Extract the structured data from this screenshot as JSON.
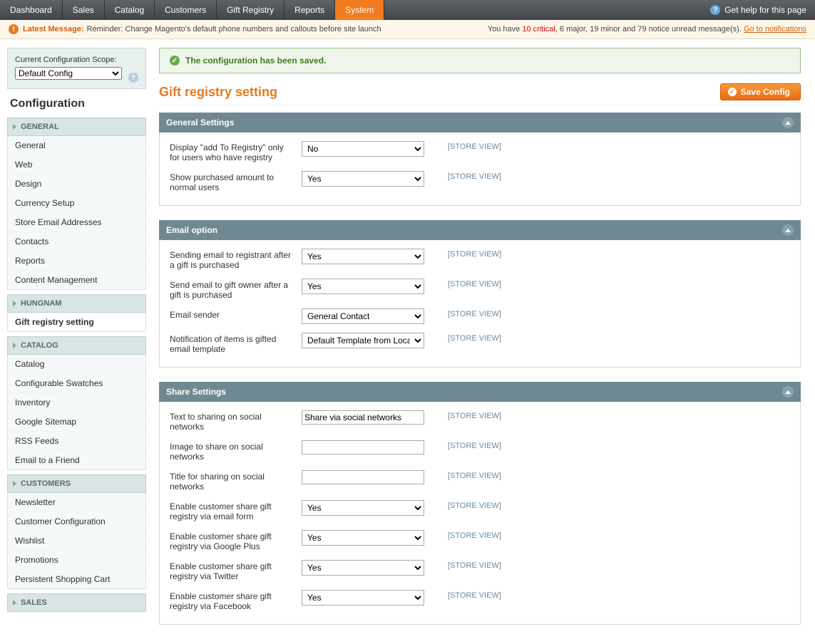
{
  "topnav": {
    "items": [
      "Dashboard",
      "Sales",
      "Catalog",
      "Customers",
      "Gift Registry",
      "Reports",
      "System"
    ],
    "active_index": 6,
    "help_label": "Get help for this page"
  },
  "noticebar": {
    "latest_label": "Latest Message:",
    "message": "Reminder: Change Magento's default phone numbers and callouts before site launch",
    "summary_pre": "You have ",
    "critical": "10 critical",
    "summary_mid": ", 6 major, 19 minor and 79 notice unread message(s). ",
    "link": "Go to notifications"
  },
  "scope": {
    "label": "Current Configuration Scope:",
    "value": "Default Config"
  },
  "sidebar_title": "Configuration",
  "groups": [
    {
      "title": "GENERAL",
      "items": [
        "General",
        "Web",
        "Design",
        "Currency Setup",
        "Store Email Addresses",
        "Contacts",
        "Reports",
        "Content Management"
      ]
    },
    {
      "title": "HUNGNAM",
      "items": [
        "Gift registry setting"
      ],
      "active_index": 0
    },
    {
      "title": "CATALOG",
      "items": [
        "Catalog",
        "Configurable Swatches",
        "Inventory",
        "Google Sitemap",
        "RSS Feeds",
        "Email to a Friend"
      ]
    },
    {
      "title": "CUSTOMERS",
      "items": [
        "Newsletter",
        "Customer Configuration",
        "Wishlist",
        "Promotions",
        "Persistent Shopping Cart"
      ]
    },
    {
      "title": "SALES",
      "items": []
    }
  ],
  "success_message": "The configuration has been saved.",
  "page_title": "Gift registry setting",
  "save_button": "Save Config",
  "scope_tag": "[STORE VIEW]",
  "sections": [
    {
      "title": "General Settings",
      "fields": [
        {
          "label": "Display \"add To Registry\" only for users who have registry",
          "type": "select",
          "value": "No"
        },
        {
          "label": "Show purchased amount to normal users",
          "type": "select",
          "value": "Yes"
        }
      ]
    },
    {
      "title": "Email option",
      "fields": [
        {
          "label": "Sending email to registrant after a gift is purchased",
          "type": "select",
          "value": "Yes"
        },
        {
          "label": "Send email to gift owner after a gift is purchased",
          "type": "select",
          "value": "Yes"
        },
        {
          "label": "Email sender",
          "type": "select",
          "value": "General Contact"
        },
        {
          "label": "Notification of items is gifted email template",
          "type": "select",
          "value": "Default Template from Locale"
        }
      ]
    },
    {
      "title": "Share Settings",
      "fields": [
        {
          "label": "Text to sharing on social networks",
          "type": "text",
          "value": "Share via social networks"
        },
        {
          "label": "Image to share on social networks",
          "type": "text",
          "value": ""
        },
        {
          "label": "Title for sharing on social networks",
          "type": "text",
          "value": ""
        },
        {
          "label": "Enable customer share gift registry via email form",
          "type": "select",
          "value": "Yes"
        },
        {
          "label": "Enable customer share gift registry via Google Plus",
          "type": "select",
          "value": "Yes"
        },
        {
          "label": "Enable customer share gift registry via Twitter",
          "type": "select",
          "value": "Yes"
        },
        {
          "label": "Enable customer share gift registry via Facebook",
          "type": "select",
          "value": "Yes"
        }
      ]
    }
  ]
}
